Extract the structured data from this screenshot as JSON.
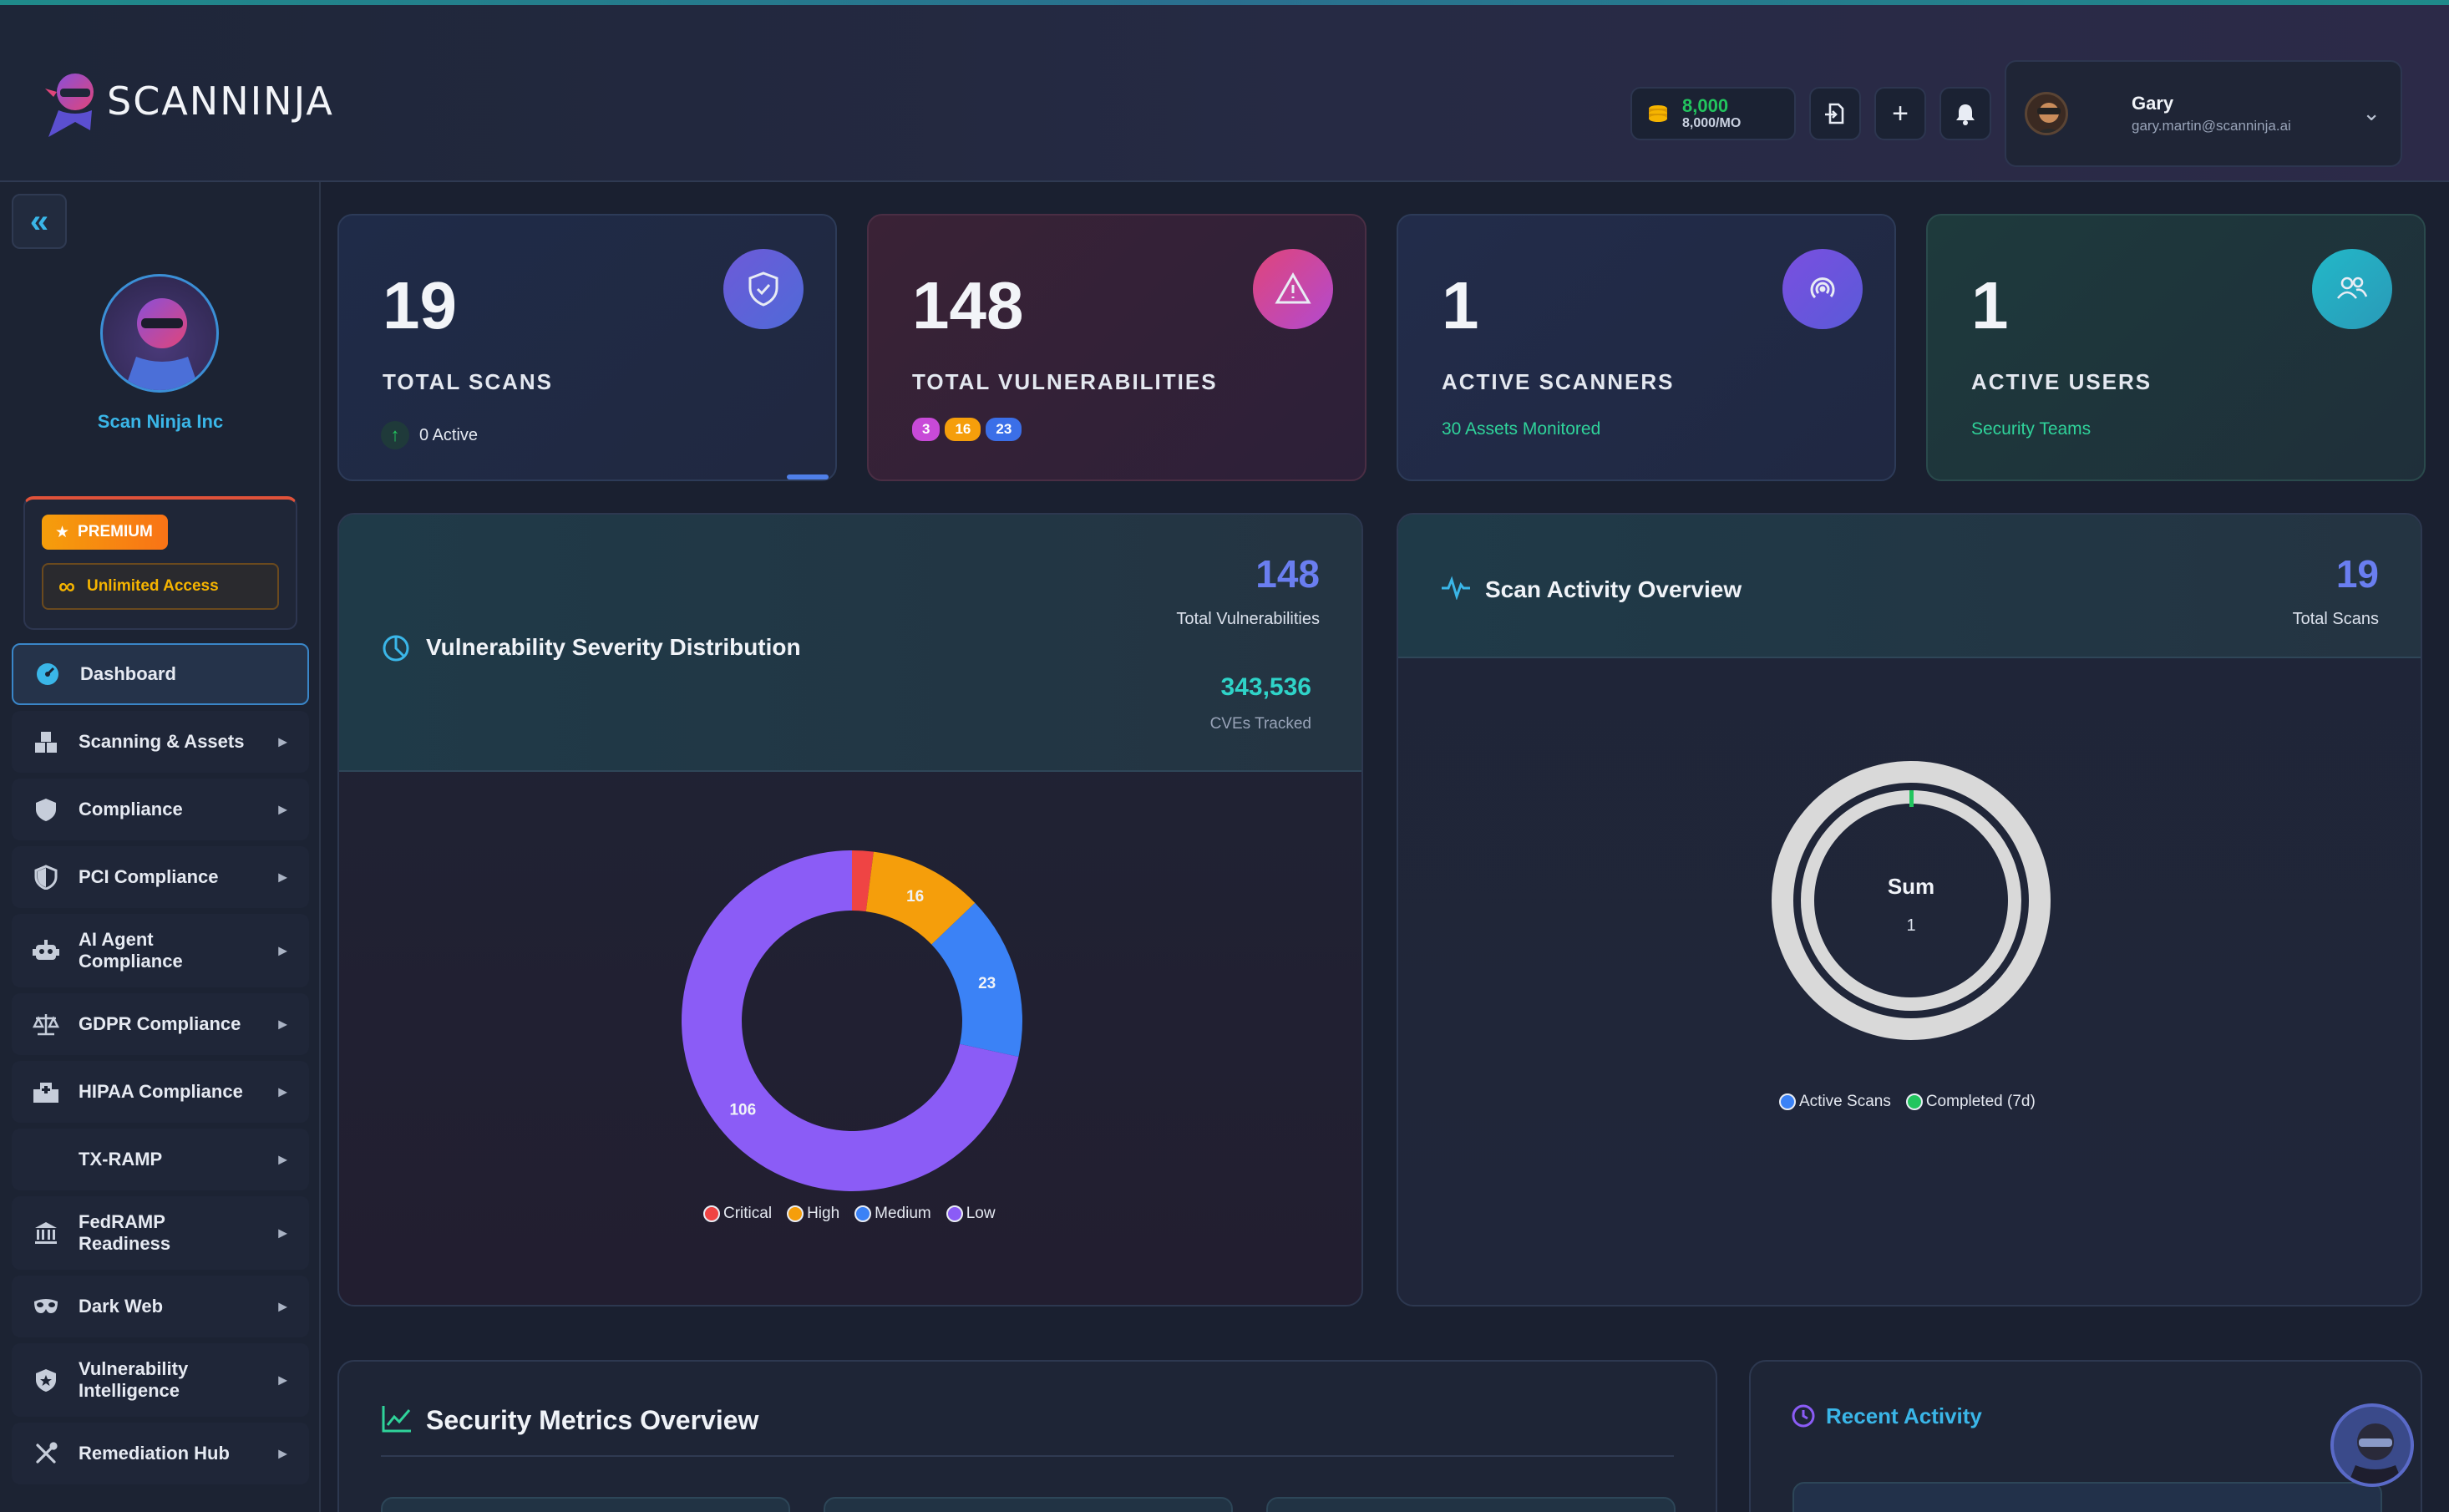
{
  "brand": {
    "name": "SCANNINJA"
  },
  "header": {
    "credits_value": "8,000",
    "credits_rate": "8,000/MO",
    "user_name": "Gary",
    "user_email": "gary.martin@scanninja.ai"
  },
  "sidebar": {
    "org_name": "Scan Ninja Inc",
    "premium_label": "PREMIUM",
    "unlimited_label": "Unlimited Access",
    "items": [
      {
        "label": "Dashboard",
        "icon": "dashboard-icon"
      },
      {
        "label": "Scanning & Assets",
        "icon": "assets-icon"
      },
      {
        "label": "Compliance",
        "icon": "shield-icon"
      },
      {
        "label": "PCI Compliance",
        "icon": "shield-half-icon"
      },
      {
        "label": "AI Agent Compliance",
        "icon": "robot-icon"
      },
      {
        "label": "GDPR Compliance",
        "icon": "scale-icon"
      },
      {
        "label": "HIPAA Compliance",
        "icon": "hospital-icon"
      },
      {
        "label": "TX-RAMP",
        "icon": ""
      },
      {
        "label": "FedRAMP Readiness",
        "icon": "landmark-icon"
      },
      {
        "label": "Dark Web",
        "icon": "mask-icon"
      },
      {
        "label": "Vulnerability Intelligence",
        "icon": "shield-star-icon"
      },
      {
        "label": "Remediation Hub",
        "icon": "tools-icon"
      }
    ]
  },
  "stats": {
    "scans": {
      "value": "19",
      "label": "TOTAL SCANS",
      "sub": "0 Active"
    },
    "vulns": {
      "value": "148",
      "label": "TOTAL VULNERABILITIES",
      "pills": [
        "3",
        "16",
        "23"
      ]
    },
    "scanners": {
      "value": "1",
      "label": "ACTIVE SCANNERS",
      "sub": "30 Assets Monitored"
    },
    "users": {
      "value": "1",
      "label": "ACTIVE USERS",
      "sub": "Security Teams"
    }
  },
  "severity_panel": {
    "title": "Vulnerability Severity Distribution",
    "total_value": "148",
    "total_label": "Total Vulnerabilities",
    "cves_value": "343,536",
    "cves_label": "CVEs Tracked",
    "legend": [
      "Critical",
      "High",
      "Medium",
      "Low"
    ],
    "colors": [
      "#ef4444",
      "#f59e0b",
      "#3b82f6",
      "#8b5cf6"
    ]
  },
  "activity_panel": {
    "title": "Scan Activity Overview",
    "total_value": "19",
    "total_label": "Total Scans",
    "center_label": "Sum",
    "center_value": "1",
    "legend": [
      "Active Scans",
      "Completed (7d)"
    ],
    "colors": [
      "#3b82f6",
      "#22c55e"
    ]
  },
  "metrics_panel": {
    "title": "Security Metrics Overview"
  },
  "recent_panel": {
    "title": "Recent Activity"
  },
  "chart_data": [
    {
      "type": "pie",
      "title": "Vulnerability Severity Distribution",
      "categories": [
        "Critical",
        "High",
        "Medium",
        "Low"
      ],
      "values": [
        3,
        16,
        23,
        106
      ]
    },
    {
      "type": "pie",
      "title": "Scan Activity Overview",
      "categories": [
        "Active Scans",
        "Completed (7d)"
      ],
      "values": [
        0,
        1
      ]
    }
  ]
}
